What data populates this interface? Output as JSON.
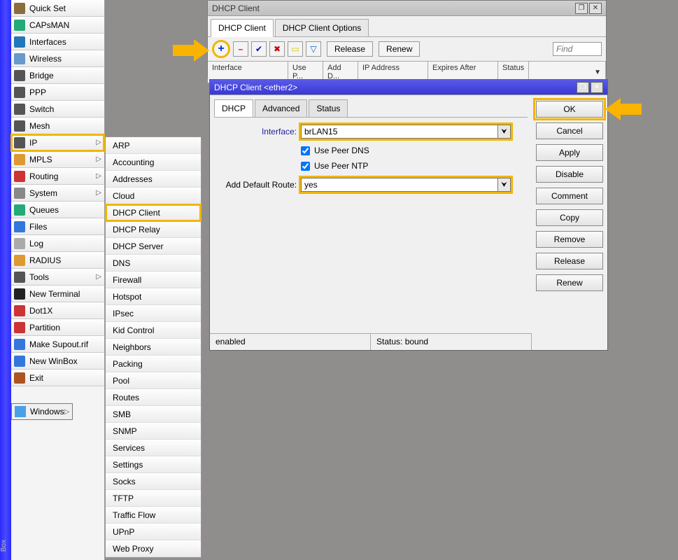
{
  "left_stripe_label": "Box",
  "sidebar": [
    {
      "label": "Quick Set"
    },
    {
      "label": "CAPsMAN"
    },
    {
      "label": "Interfaces"
    },
    {
      "label": "Wireless"
    },
    {
      "label": "Bridge"
    },
    {
      "label": "PPP"
    },
    {
      "label": "Switch"
    },
    {
      "label": "Mesh"
    },
    {
      "label": "IP",
      "arrow": true,
      "hl": true
    },
    {
      "label": "MPLS",
      "arrow": true
    },
    {
      "label": "Routing",
      "arrow": true
    },
    {
      "label": "System",
      "arrow": true
    },
    {
      "label": "Queues"
    },
    {
      "label": "Files"
    },
    {
      "label": "Log"
    },
    {
      "label": "RADIUS"
    },
    {
      "label": "Tools",
      "arrow": true
    },
    {
      "label": "New Terminal"
    },
    {
      "label": "Dot1X"
    },
    {
      "label": "Partition"
    },
    {
      "label": "Make Supout.rif"
    },
    {
      "label": "New WinBox"
    },
    {
      "label": "Exit"
    }
  ],
  "sidebar_windows_label": "Windows",
  "submenu": [
    "ARP",
    "Accounting",
    "Addresses",
    "Cloud",
    "DHCP Client",
    "DHCP Relay",
    "DHCP Server",
    "DNS",
    "Firewall",
    "Hotspot",
    "IPsec",
    "Kid Control",
    "Neighbors",
    "Packing",
    "Pool",
    "Routes",
    "SMB",
    "SNMP",
    "Services",
    "Settings",
    "Socks",
    "TFTP",
    "Traffic Flow",
    "UPnP",
    "Web Proxy"
  ],
  "submenu_hl_index": 4,
  "dhcp_list_win": {
    "title": "DHCP Client",
    "tabs": [
      "DHCP Client",
      "DHCP Client Options"
    ],
    "active_tab": 0,
    "toolbar_buttons": {
      "release": "Release",
      "renew": "Renew"
    },
    "find_placeholder": "Find",
    "columns": [
      "Interface",
      "Use P...",
      "Add D...",
      "IP Address",
      "Expires After",
      "Status"
    ]
  },
  "edit_win": {
    "title": "DHCP Client <ether2>",
    "tabs": [
      "DHCP",
      "Advanced",
      "Status"
    ],
    "active_tab": 0,
    "interface_label": "Interface:",
    "interface_value": "brLAN15",
    "use_peer_dns_label": "Use Peer DNS",
    "use_peer_dns_checked": true,
    "use_peer_ntp_label": "Use Peer NTP",
    "use_peer_ntp_checked": true,
    "add_default_route_label": "Add Default Route:",
    "add_default_route_value": "yes",
    "buttons": [
      "OK",
      "Cancel",
      "Apply",
      "Disable",
      "Comment",
      "Copy",
      "Remove",
      "Release",
      "Renew"
    ],
    "button_hl_index": 0,
    "status_left": "enabled",
    "status_right": "Status: bound"
  }
}
